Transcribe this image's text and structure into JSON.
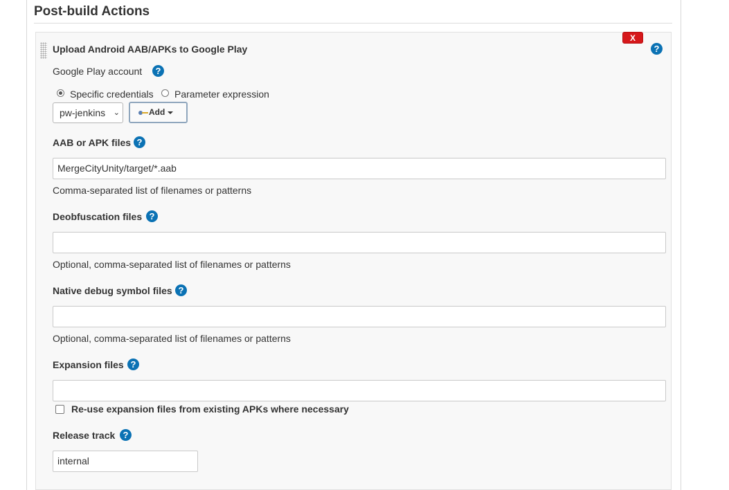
{
  "section": {
    "title": "Post-build Actions"
  },
  "step": {
    "title": "Upload Android AAB/APKs to Google Play",
    "delete_label": "X",
    "help_glyph": "?"
  },
  "google_play_account": {
    "label": "Google Play account",
    "radio_specific": "Specific credentials",
    "radio_parameter": "Parameter expression",
    "selected_mode": "Specific credentials",
    "credential_value": "pw-jenkins",
    "add_button_label": "Add"
  },
  "apk_files": {
    "label": "AAB or APK files",
    "value": "MergeCityUnity/target/*.aab",
    "description": "Comma-separated list of filenames or patterns"
  },
  "deobfuscation_files": {
    "label": "Deobfuscation files",
    "value": "",
    "description": "Optional, comma-separated list of filenames or patterns"
  },
  "native_debug_files": {
    "label": "Native debug symbol files",
    "value": "",
    "description": "Optional, comma-separated list of filenames or patterns"
  },
  "expansion_files": {
    "label": "Expansion files",
    "value": "",
    "reuse_checkbox_label": "Re-use expansion files from existing APKs where necessary",
    "reuse_checked": false
  },
  "release_track": {
    "label": "Release track",
    "value": "internal"
  },
  "colors": {
    "help_blue": "#0b72b4",
    "delete_red": "#d6181b",
    "panel_bg": "#f8f8f8"
  },
  "icons": {
    "help": "help-circle-icon",
    "delete": "close-icon",
    "add": "key-icon",
    "drag": "drag-handle-icon"
  }
}
